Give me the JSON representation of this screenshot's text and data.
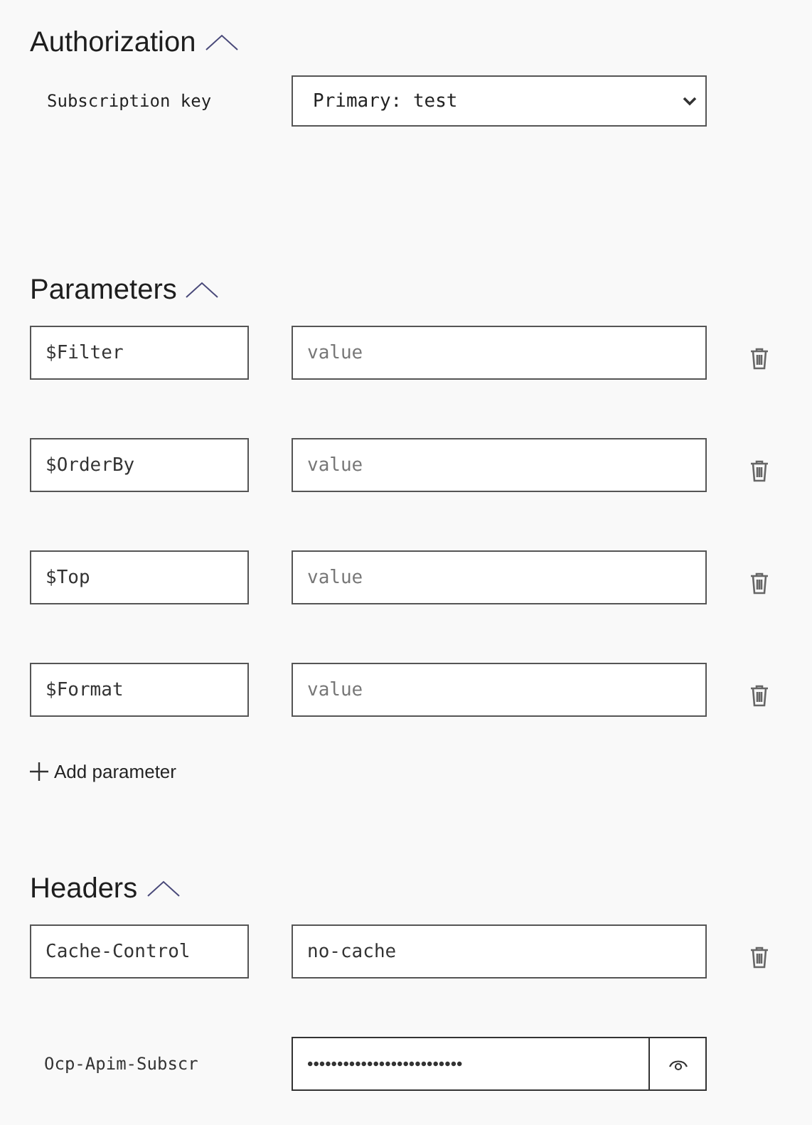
{
  "authorization": {
    "title": "Authorization",
    "expanded": true,
    "label": "Subscription key",
    "value": "Primary: test"
  },
  "parameters": {
    "title": "Parameters",
    "expanded": true,
    "rows": [
      {
        "name": "$Filter",
        "placeholder": "value"
      },
      {
        "name": "$OrderBy",
        "placeholder": "value"
      },
      {
        "name": "$Top",
        "placeholder": "value"
      },
      {
        "name": "$Format",
        "placeholder": "value"
      }
    ],
    "add_label": "Add parameter"
  },
  "headers": {
    "title": "Headers",
    "expanded": true,
    "rows": [
      {
        "kind": "editable",
        "name": "Cache-Control",
        "value": "no-cache"
      },
      {
        "kind": "secret",
        "name": "Ocp-Apim-Subscr",
        "value": "••••••••••••••••••••••••••"
      }
    ]
  }
}
